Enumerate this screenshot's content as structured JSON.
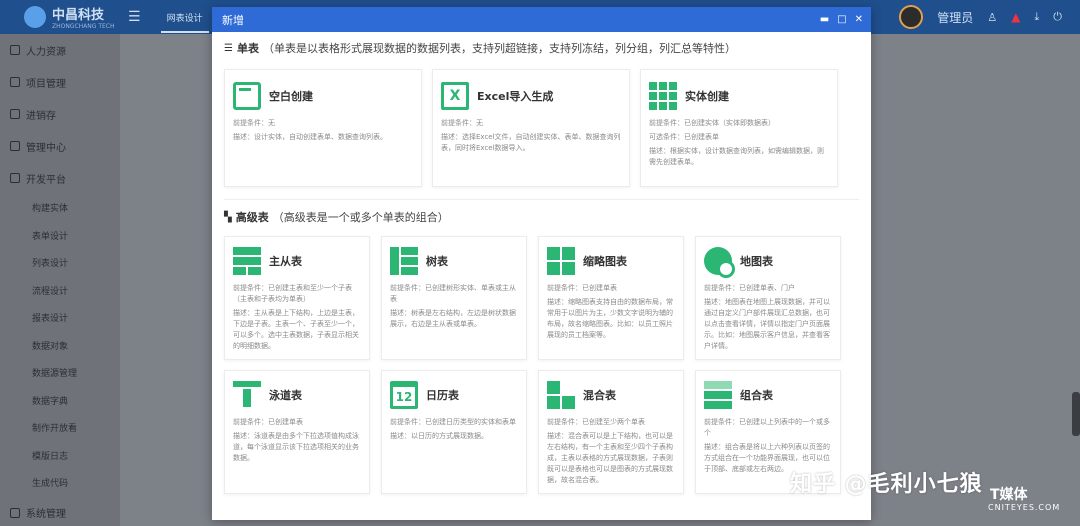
{
  "app": {
    "logo_text": "中昌科技",
    "logo_sub": "ZHONGCHANG TECH",
    "top_tab": "网表设计",
    "user_name": "管理员"
  },
  "sidebar": {
    "groups": [
      {
        "label": "人力资源"
      },
      {
        "label": "项目管理"
      },
      {
        "label": "进销存"
      },
      {
        "label": "管理中心"
      },
      {
        "label": "开发平台"
      }
    ],
    "sub_items": [
      {
        "label": "构建实体"
      },
      {
        "label": "表单设计"
      },
      {
        "label": "列表设计"
      },
      {
        "label": "流程设计"
      },
      {
        "label": "报表设计"
      },
      {
        "label": "数据对象"
      },
      {
        "label": "数据源管理"
      },
      {
        "label": "数据字典"
      },
      {
        "label": "制作开放看"
      },
      {
        "label": "模版日志"
      },
      {
        "label": "生成代码"
      }
    ],
    "bottom": {
      "label": "系统管理"
    }
  },
  "modal": {
    "title": "新增",
    "single_section": {
      "name": "单表",
      "desc": "（单表是以表格形式展现数据的数据列表，支持列超链接，支持列冻结，列分组，列汇总等特性）"
    },
    "single_cards": [
      {
        "icon": "blank-table-icon",
        "title": "空白创建",
        "cond": "前提条件：无",
        "desc": "描述：设计实体，自动创建表单、数据查询列表。"
      },
      {
        "icon": "excel-icon",
        "title": "Excel导入生成",
        "cond": "前提条件：无",
        "desc": "描述：选择Excel文件，自动创建实体、表单、数据查询列表，同时将Excel数据导入。"
      },
      {
        "icon": "grid-icon",
        "title": "实体创建",
        "cond": "前提条件：已创建实体（实体即数据表）",
        "extra": "可选条件：已创建表单",
        "desc": "描述：根据实体，设计数据查询列表，如需编辑数据，则需先创建表单。"
      }
    ],
    "advanced_section": {
      "name": "高级表",
      "desc": "（高级表是一个或多个单表的组合）"
    },
    "advanced_cards": [
      {
        "icon": "master-detail-icon",
        "title": "主从表",
        "cond": "前提条件：已创建主表和至少一个子表（主表和子表均为单表）",
        "desc": "描述：主从表是上下结构，上边是主表，下边是子表。主表一个、子表至少一个，可以多个。选中主表数据，子表显示相关的明细数据。"
      },
      {
        "icon": "tree-icon",
        "title": "树表",
        "cond": "前提条件：已创建树形实体、单表或主从表",
        "desc": "描述：树表是左右结构，左边是树状数据展示，右边是主从表或单表。"
      },
      {
        "icon": "thumbnail-icon",
        "title": "缩略图表",
        "cond": "前提条件：已创建单表",
        "desc": "描述：缩略图表支持自由的数据布局，常常用于以图片为主，少数文字说明为辅的布局，故名缩略图表。比如：以员工照片展现的员工档案等。"
      },
      {
        "icon": "map-icon",
        "title": "地图表",
        "cond": "前提条件：已创建单表、门户",
        "desc": "描述：地图表在地图上展现数据，并可以通过自定义门户部件展现汇总数据，也可以点击查看详情，详情以指定门户页面展示。比如：地图展示客户信息，并查看客户详情。"
      },
      {
        "icon": "swimlane-icon",
        "title": "泳道表",
        "cond": "前提条件：已创建单表",
        "desc": "描述：泳道表是由多个下拉选项值构成泳道，每个泳道显示该下拉选项相关的业务数据。"
      },
      {
        "icon": "calendar-icon",
        "title": "日历表",
        "cond": "前提条件：已创建日历类型的实体和表单",
        "desc": "描述：以日历的方式展现数据。"
      },
      {
        "icon": "mixed-icon",
        "title": "混合表",
        "cond": "前提条件：已创建至少两个单表",
        "desc": "描述：混合表可以是上下结构，也可以是左右结构，有一个主表和至少四个子表构成，主表以表格的方式展现数据，子表则既可以是表格也可以是图表的方式展现数据，故名混合表。"
      },
      {
        "icon": "combo-icon",
        "title": "组合表",
        "cond": "前提条件：已创建以上列表中的一个或多个",
        "desc": "描述：组合表是将以上六种列表以页签的方式组合在一个功能界面展现，也可以位于顶部、底部或左右两边。"
      }
    ]
  },
  "watermark": {
    "text": "知乎 @毛利小七狼",
    "logo": "T媒体",
    "site": "CNITEYES.COM"
  }
}
